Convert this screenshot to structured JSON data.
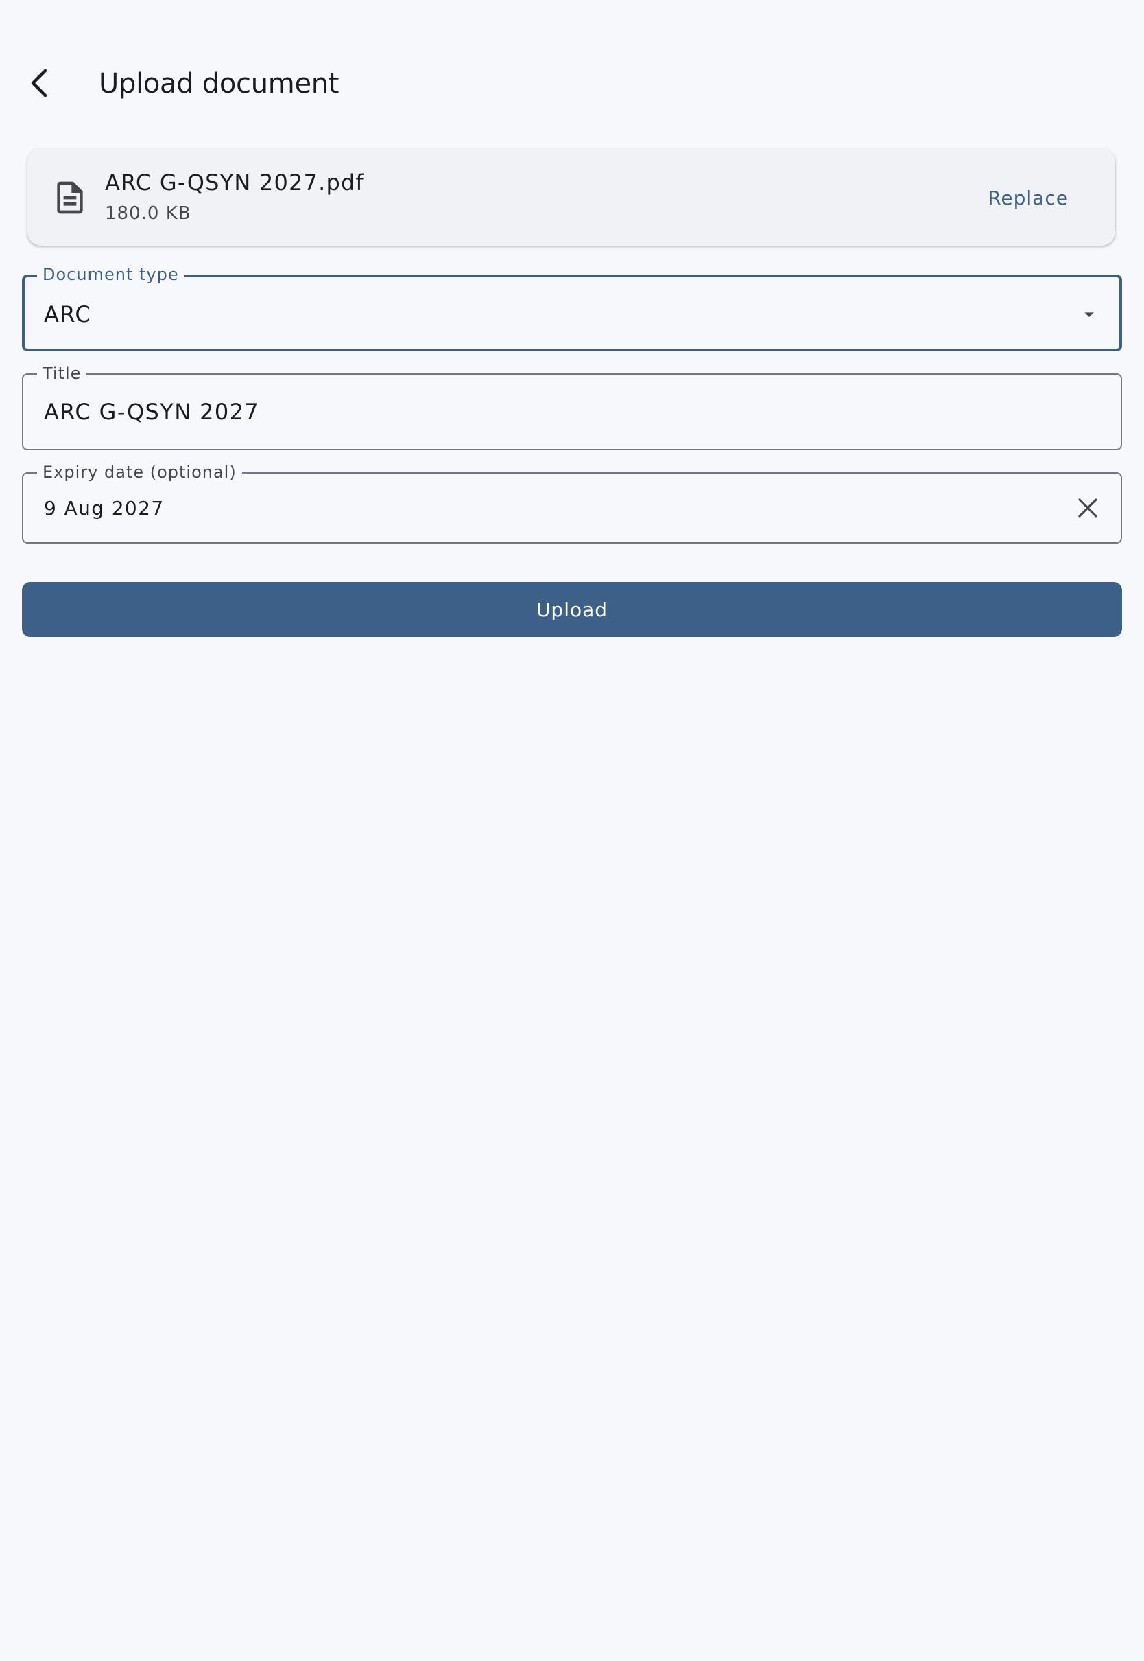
{
  "header": {
    "title": "Upload document"
  },
  "file": {
    "name": "ARC G-QSYN 2027.pdf",
    "size": "180.0 KB",
    "replace_label": "Replace",
    "icon": "document-icon"
  },
  "form": {
    "document_type": {
      "label": "Document type",
      "value": "ARC"
    },
    "title": {
      "label": "Title",
      "value": "ARC G-QSYN 2027"
    },
    "expiry_date": {
      "label": "Expiry date (optional)",
      "value": "9 Aug 2027"
    }
  },
  "actions": {
    "upload_label": "Upload"
  },
  "colors": {
    "background": "#f7f8fc",
    "primary": "#3d6089",
    "card": "#f1f2f6",
    "outline": "#74777f",
    "text": "#1b1c1f",
    "secondary_text": "#44474e"
  }
}
